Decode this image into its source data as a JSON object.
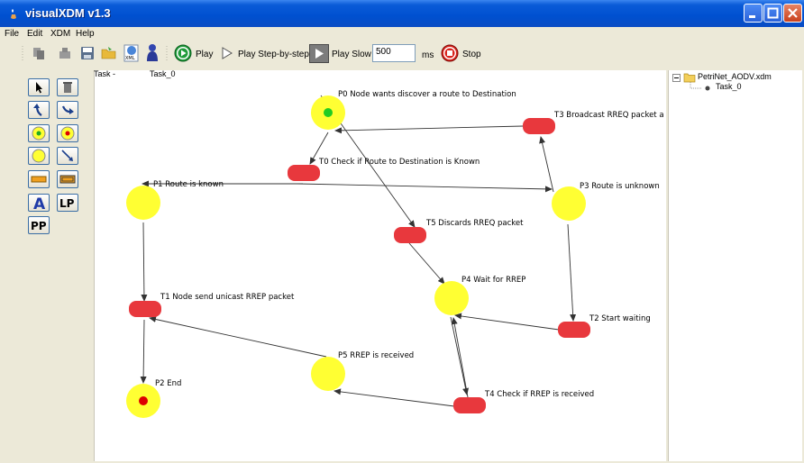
{
  "window": {
    "title": "visualXDM  v1.3"
  },
  "menu": {
    "file": "File",
    "edit": "Edit",
    "xdm": "XDM",
    "help": "Help"
  },
  "toolbar": {
    "play": "Play",
    "play_step": "Play Step-by-step",
    "play_slow": "Play Slow",
    "slow_value": "500",
    "ms": "ms",
    "stop": "Stop"
  },
  "palette": {
    "label_button": "LP",
    "pp_button": "PP"
  },
  "canvas": {
    "task_label": "Task -",
    "task_name": "Task_0"
  },
  "tree": {
    "root": "PetriNet_AODV.xdm",
    "child": "Task_0"
  },
  "colors": {
    "place": "#ffff33",
    "transition": "#e8383d",
    "token_green": "#22cc22",
    "token_red": "#dd0000"
  },
  "places": [
    {
      "id": "P0",
      "label": "P0 Node wants discover a route to Destination",
      "token": "green"
    },
    {
      "id": "P1",
      "label": "P1 Route is known",
      "token": ""
    },
    {
      "id": "P2",
      "label": "P2 End",
      "token": "red"
    },
    {
      "id": "P3",
      "label": "P3 Route is unknown",
      "token": ""
    },
    {
      "id": "P4",
      "label": "P4 Wait for RREP",
      "token": ""
    },
    {
      "id": "P5",
      "label": "P5 RREP is received",
      "token": ""
    }
  ],
  "transitions": [
    {
      "id": "T0",
      "label": "T0 Check if Route to Destination is Known"
    },
    {
      "id": "T1",
      "label": "T1 Node send unicast RREP packet"
    },
    {
      "id": "T2",
      "label": "T2 Start waiting"
    },
    {
      "id": "T3",
      "label": "T3 Broadcast RREQ packet a"
    },
    {
      "id": "T4",
      "label": "T4 Check if RREP is received"
    },
    {
      "id": "T5",
      "label": "T5 Discards RREQ packet"
    }
  ]
}
